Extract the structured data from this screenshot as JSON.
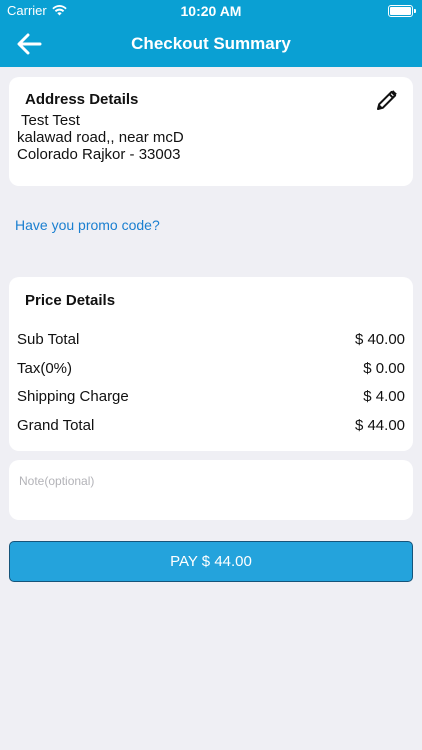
{
  "status_bar": {
    "carrier": "Carrier",
    "time": "10:20 AM"
  },
  "header": {
    "title": "Checkout Summary",
    "back_icon": "arrow-left-icon"
  },
  "address": {
    "heading": "Address Details",
    "edit_icon": "pencil-icon",
    "name": "Test Test",
    "street": "kalawad road,, near mcD",
    "city_line": "Colorado Rajkor - 33003"
  },
  "promo": {
    "link_text": "Have you promo code?"
  },
  "price_details": {
    "heading": "Price Details",
    "rows": [
      {
        "label": "Sub Total",
        "value": "$ 40.00"
      },
      {
        "label": "Tax(0%)",
        "value": "$ 0.00"
      },
      {
        "label": "Shipping Charge",
        "value": "$ 4.00"
      },
      {
        "label": "Grand Total",
        "value": "$ 44.00"
      }
    ]
  },
  "note": {
    "placeholder": "Note(optional)",
    "value": ""
  },
  "pay": {
    "label": "PAY $ 44.00"
  },
  "colors": {
    "header": "#0aa0d3",
    "pay_button": "#24a3dc",
    "link": "#1a7fd0",
    "background": "#efeff4"
  }
}
